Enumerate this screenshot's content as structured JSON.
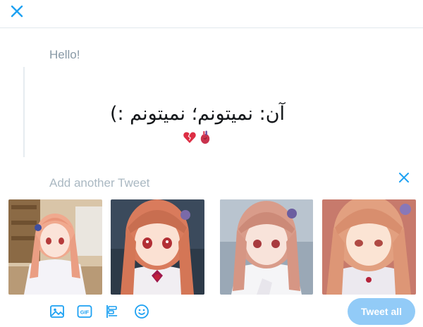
{
  "composer": {
    "first_tweet_text": "Hello!",
    "second_tweet_placeholder": "Add another Tweet",
    "tweet_all_label": "Tweet all"
  },
  "tweet_content": {
    "persian_text": "آن: نمیتونم؛ نمیتونم :)",
    "emojis": [
      "broken-heart",
      "anatomical-heart"
    ]
  },
  "icons": {
    "close": "close-icon",
    "remove": "remove-tweet-icon",
    "toolbar": [
      "image-icon",
      "gif-icon",
      "poll-icon",
      "emoji-icon"
    ]
  },
  "media": [
    {
      "name": "anime-girl-photo-1"
    },
    {
      "name": "anime-girl-photo-2"
    },
    {
      "name": "anime-girl-photo-3"
    },
    {
      "name": "anime-girl-photo-4"
    }
  ],
  "colors": {
    "accent": "#1da1f2",
    "button_disabled": "#92cbf7",
    "placeholder": "#aab8c2"
  }
}
